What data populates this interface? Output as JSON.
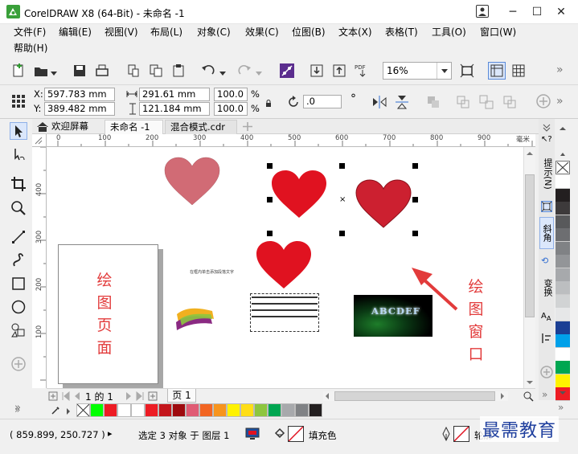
{
  "window": {
    "title": "CorelDRAW X8 (64-Bit) - 未命名 -1",
    "min_glyph": "─",
    "max_glyph": "☐",
    "close_glyph": "✕"
  },
  "menu": {
    "items": [
      "文件(F)",
      "编辑(E)",
      "视图(V)",
      "布局(L)",
      "对象(C)",
      "效果(C)",
      "位图(B)",
      "文本(X)",
      "表格(T)",
      "工具(O)",
      "窗口(W)"
    ],
    "help": "帮助(H)"
  },
  "toolbar": {
    "zoom_value": "16%",
    "more": "»"
  },
  "properties": {
    "x_label": "X:",
    "x_value": "597.783 mm",
    "y_label": "Y:",
    "y_value": "389.482 mm",
    "width_value": "291.61 mm",
    "height_value": "121.184 mm",
    "scale_w": "100.0",
    "scale_h": "100.0",
    "percent": "%",
    "rotation": ".0",
    "degree": "°"
  },
  "tabs": [
    {
      "label": "欢迎屏幕"
    },
    {
      "label": "未命名 -1"
    },
    {
      "label": "混合模式.cdr"
    }
  ],
  "ruler": {
    "h_labels": [
      "0",
      "100",
      "200",
      "300",
      "400",
      "500",
      "600",
      "700",
      "800",
      "900"
    ],
    "h_unit": "毫米",
    "v_labels": [
      "400",
      "300",
      "200",
      "100"
    ]
  },
  "canvas": {
    "small_text": "在框内单击添加段落文字",
    "art_text": "ABCDEF",
    "page_label": [
      "绘",
      "图",
      "页",
      "面"
    ],
    "window_label": [
      "绘",
      "图",
      "窗",
      "口"
    ]
  },
  "pagebar": {
    "page_of": "1 的 1",
    "page_tab": "页 1"
  },
  "dock": {
    "tabs": [
      "提示(N)",
      "斜角",
      "变换"
    ]
  },
  "palette": {
    "vertical": [
      "#ffffff",
      "#231f20",
      "#3d3a3b",
      "#58595b",
      "#6d6e71",
      "#808285",
      "#939598",
      "#a7a9ac",
      "#bcbec0",
      "#d1d3d4",
      "#e6e7e8",
      "#1b3f94",
      "#00a0e9",
      "#ffffff",
      "#00a651",
      "#fff200",
      "#ed1c24"
    ],
    "horizontal": [
      "#00ff00",
      "#ed1c24",
      "#ffffff",
      "#ffffff",
      "#ed1c24",
      "#c4161c",
      "#9e0b0f",
      "#e05b74",
      "#f26522",
      "#f7941d",
      "#fff200",
      "#ffde17",
      "#8dc63f",
      "#00a651",
      "#a7a9ac",
      "#808285",
      "#231f20"
    ]
  },
  "status": {
    "coords": "( 859.899, 250.727 )",
    "arrow": "▸",
    "selection": "选定 3 对象 于 图层 1",
    "fill_label": "填充色",
    "outline_label": "轮廓"
  },
  "watermark": "最需教育"
}
